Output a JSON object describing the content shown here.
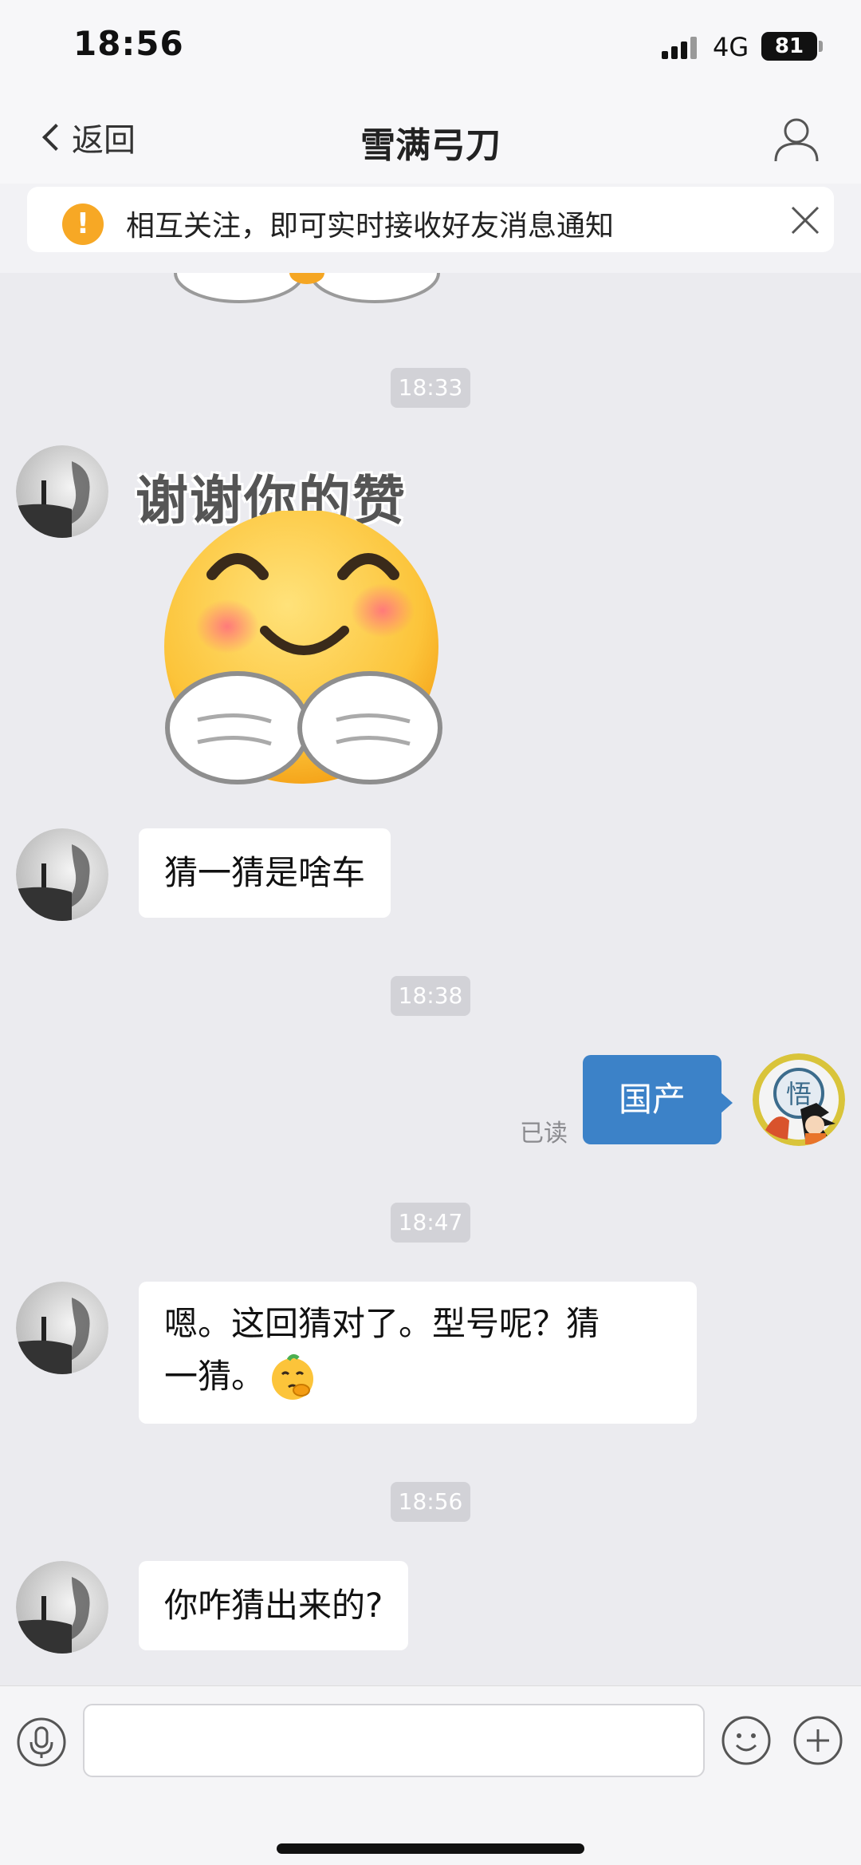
{
  "status_bar": {
    "time": "18:56",
    "network": "4G",
    "battery": "81"
  },
  "nav": {
    "back_label": "返回",
    "title": "雪满弓刀"
  },
  "notice": {
    "text": "相互关注，即可实时接收好友消息通知",
    "icon": "!"
  },
  "messages": {
    "t1": "18:33",
    "sticker_caption": "谢谢你的赞",
    "m1": "猜一猜是啥车",
    "t2": "18:38",
    "out1": "国产",
    "out1_status": "已读",
    "t3": "18:47",
    "m2_line1": "嗯。这回猜对了。型号呢？猜",
    "m2_line2": "一猜。",
    "t4": "18:56",
    "m3": "你咋猜出来的?"
  },
  "input": {
    "placeholder": ""
  },
  "colors": {
    "chat_bg": "#ebebef",
    "outgoing_bubble": "#3c82c8",
    "incoming_bubble": "#ffffff",
    "warning": "#f7a825"
  }
}
